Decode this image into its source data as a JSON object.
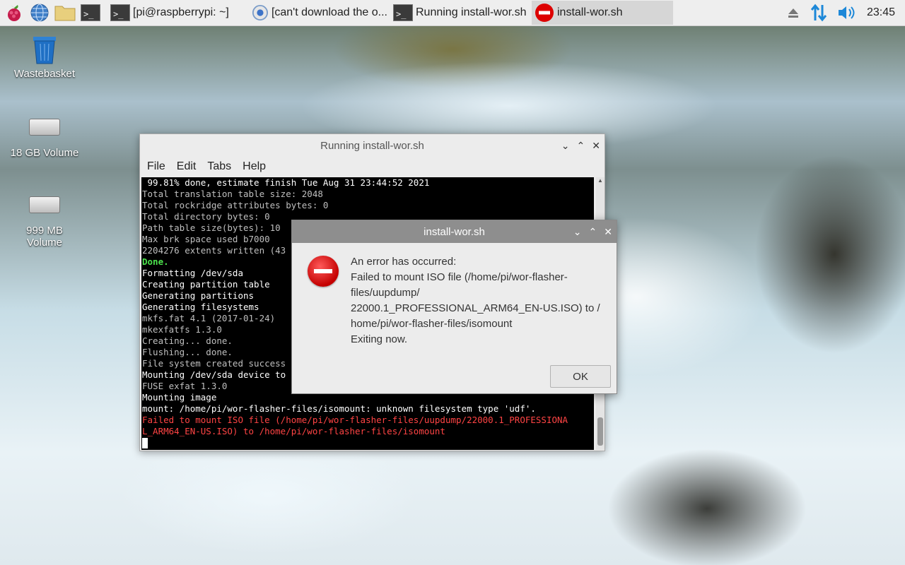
{
  "taskbar": {
    "launchers": [
      {
        "name": "raspberry-menu-icon"
      },
      {
        "name": "web-browser-icon"
      },
      {
        "name": "file-manager-icon"
      },
      {
        "name": "terminal-icon"
      }
    ],
    "tasks": [
      {
        "label": "[pi@raspberrypi: ~]",
        "icon": "terminal-icon",
        "active": false
      },
      {
        "label": "[can't download the o...",
        "icon": "chromium-icon",
        "active": false
      },
      {
        "label": "Running install-wor.sh",
        "icon": "terminal-icon",
        "active": false
      },
      {
        "label": "install-wor.sh",
        "icon": "error-icon",
        "active": true
      }
    ],
    "tray": {
      "clock": "23:45"
    }
  },
  "desktop": {
    "icons": [
      {
        "label": "Wastebasket"
      },
      {
        "label": "18 GB Volume"
      },
      {
        "label": "999 MB Volume"
      }
    ]
  },
  "terminal_window": {
    "title": "Running install-wor.sh",
    "menu": [
      "File",
      "Edit",
      "Tabs",
      "Help"
    ],
    "lines": [
      " 99.81% done, estimate finish Tue Aug 31 23:44:52 2021",
      "Total translation table size: 2048",
      "Total rockridge attributes bytes: 0",
      "Total directory bytes: 0",
      "Path table size(bytes): 10",
      "Max brk space used b7000",
      "2204276 extents written (43",
      "Done.",
      "Formatting /dev/sda",
      "Creating partition table",
      "Generating partitions",
      "Generating filesystems",
      "mkfs.fat 4.1 (2017-01-24)",
      "mkexfatfs 1.3.0",
      "Creating... done.",
      "Flushing... done.",
      "File system created success",
      "Mounting /dev/sda device to",
      "FUSE exfat 1.3.0",
      "Mounting image",
      "mount: /home/pi/wor-flasher-files/isomount: unknown filesystem type 'udf'.",
      "Failed to mount ISO file (/home/pi/wor-flasher-files/uupdump/22000.1_PROFESSIONA",
      "L_ARM64_EN-US.ISO) to /home/pi/wor-flasher-files/isomount"
    ]
  },
  "dialog": {
    "title": "install-wor.sh",
    "message_lines": [
      "An error has occurred:",
      "Failed to mount ISO file (/home/pi/wor-flasher-",
      "files/uupdump/",
      "22000.1_PROFESSIONAL_ARM64_EN-US.ISO) to /",
      "home/pi/wor-flasher-files/isomount",
      "Exiting now."
    ],
    "ok_label": "OK"
  },
  "colors": {
    "taskbar_bg": "#eeeeee",
    "terminal_bg": "#000000",
    "terminal_green": "#4ce34c",
    "terminal_red": "#ff4444",
    "dialog_title_bg": "#8e8e8e",
    "error_red": "#c40000"
  }
}
